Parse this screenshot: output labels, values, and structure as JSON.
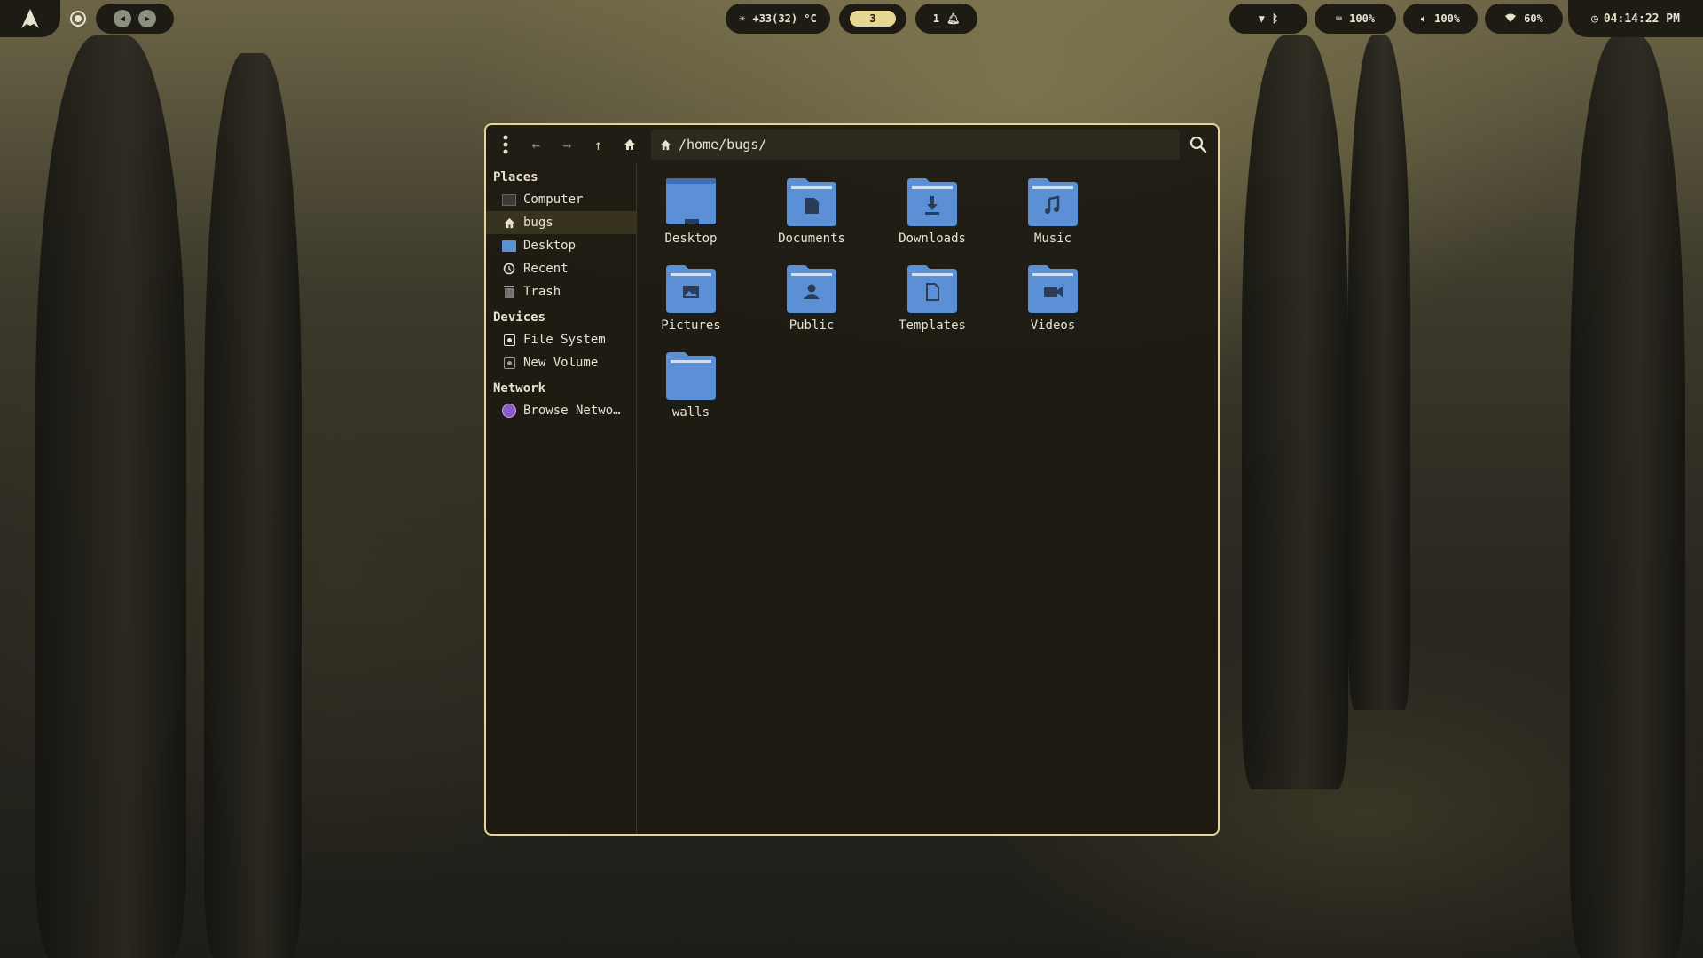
{
  "topbar": {
    "weather": "+33(32) °C",
    "workspace": "3",
    "notifications": "1",
    "keyboard": "100%",
    "volume": "100%",
    "wifi": "60%",
    "clock": "04:14:22 PM"
  },
  "window": {
    "path": "/home/bugs/",
    "sidebar": {
      "places_header": "Places",
      "places": [
        {
          "label": "Computer",
          "icon": "computer-icon"
        },
        {
          "label": "bugs",
          "icon": "home-icon"
        },
        {
          "label": "Desktop",
          "icon": "desktop-icon"
        },
        {
          "label": "Recent",
          "icon": "clock-icon"
        },
        {
          "label": "Trash",
          "icon": "trash-icon"
        }
      ],
      "devices_header": "Devices",
      "devices": [
        {
          "label": "File System",
          "icon": "drive-icon"
        },
        {
          "label": "New Volume",
          "icon": "drive-icon"
        }
      ],
      "network_header": "Network",
      "network": [
        {
          "label": "Browse Netwo…",
          "icon": "network-icon"
        }
      ]
    },
    "files": [
      {
        "name": "Desktop",
        "icon": "desktop-folder-icon"
      },
      {
        "name": "Documents",
        "icon": "documents-folder-icon"
      },
      {
        "name": "Downloads",
        "icon": "downloads-folder-icon"
      },
      {
        "name": "Music",
        "icon": "music-folder-icon"
      },
      {
        "name": "Pictures",
        "icon": "pictures-folder-icon"
      },
      {
        "name": "Public",
        "icon": "public-folder-icon"
      },
      {
        "name": "Templates",
        "icon": "templates-folder-icon"
      },
      {
        "name": "Videos",
        "icon": "videos-folder-icon"
      },
      {
        "name": "walls",
        "icon": "folder-icon"
      }
    ]
  },
  "colors": {
    "accent": "#e7d592",
    "folder": "#5b8fd6",
    "panel": "#1d1b14"
  }
}
